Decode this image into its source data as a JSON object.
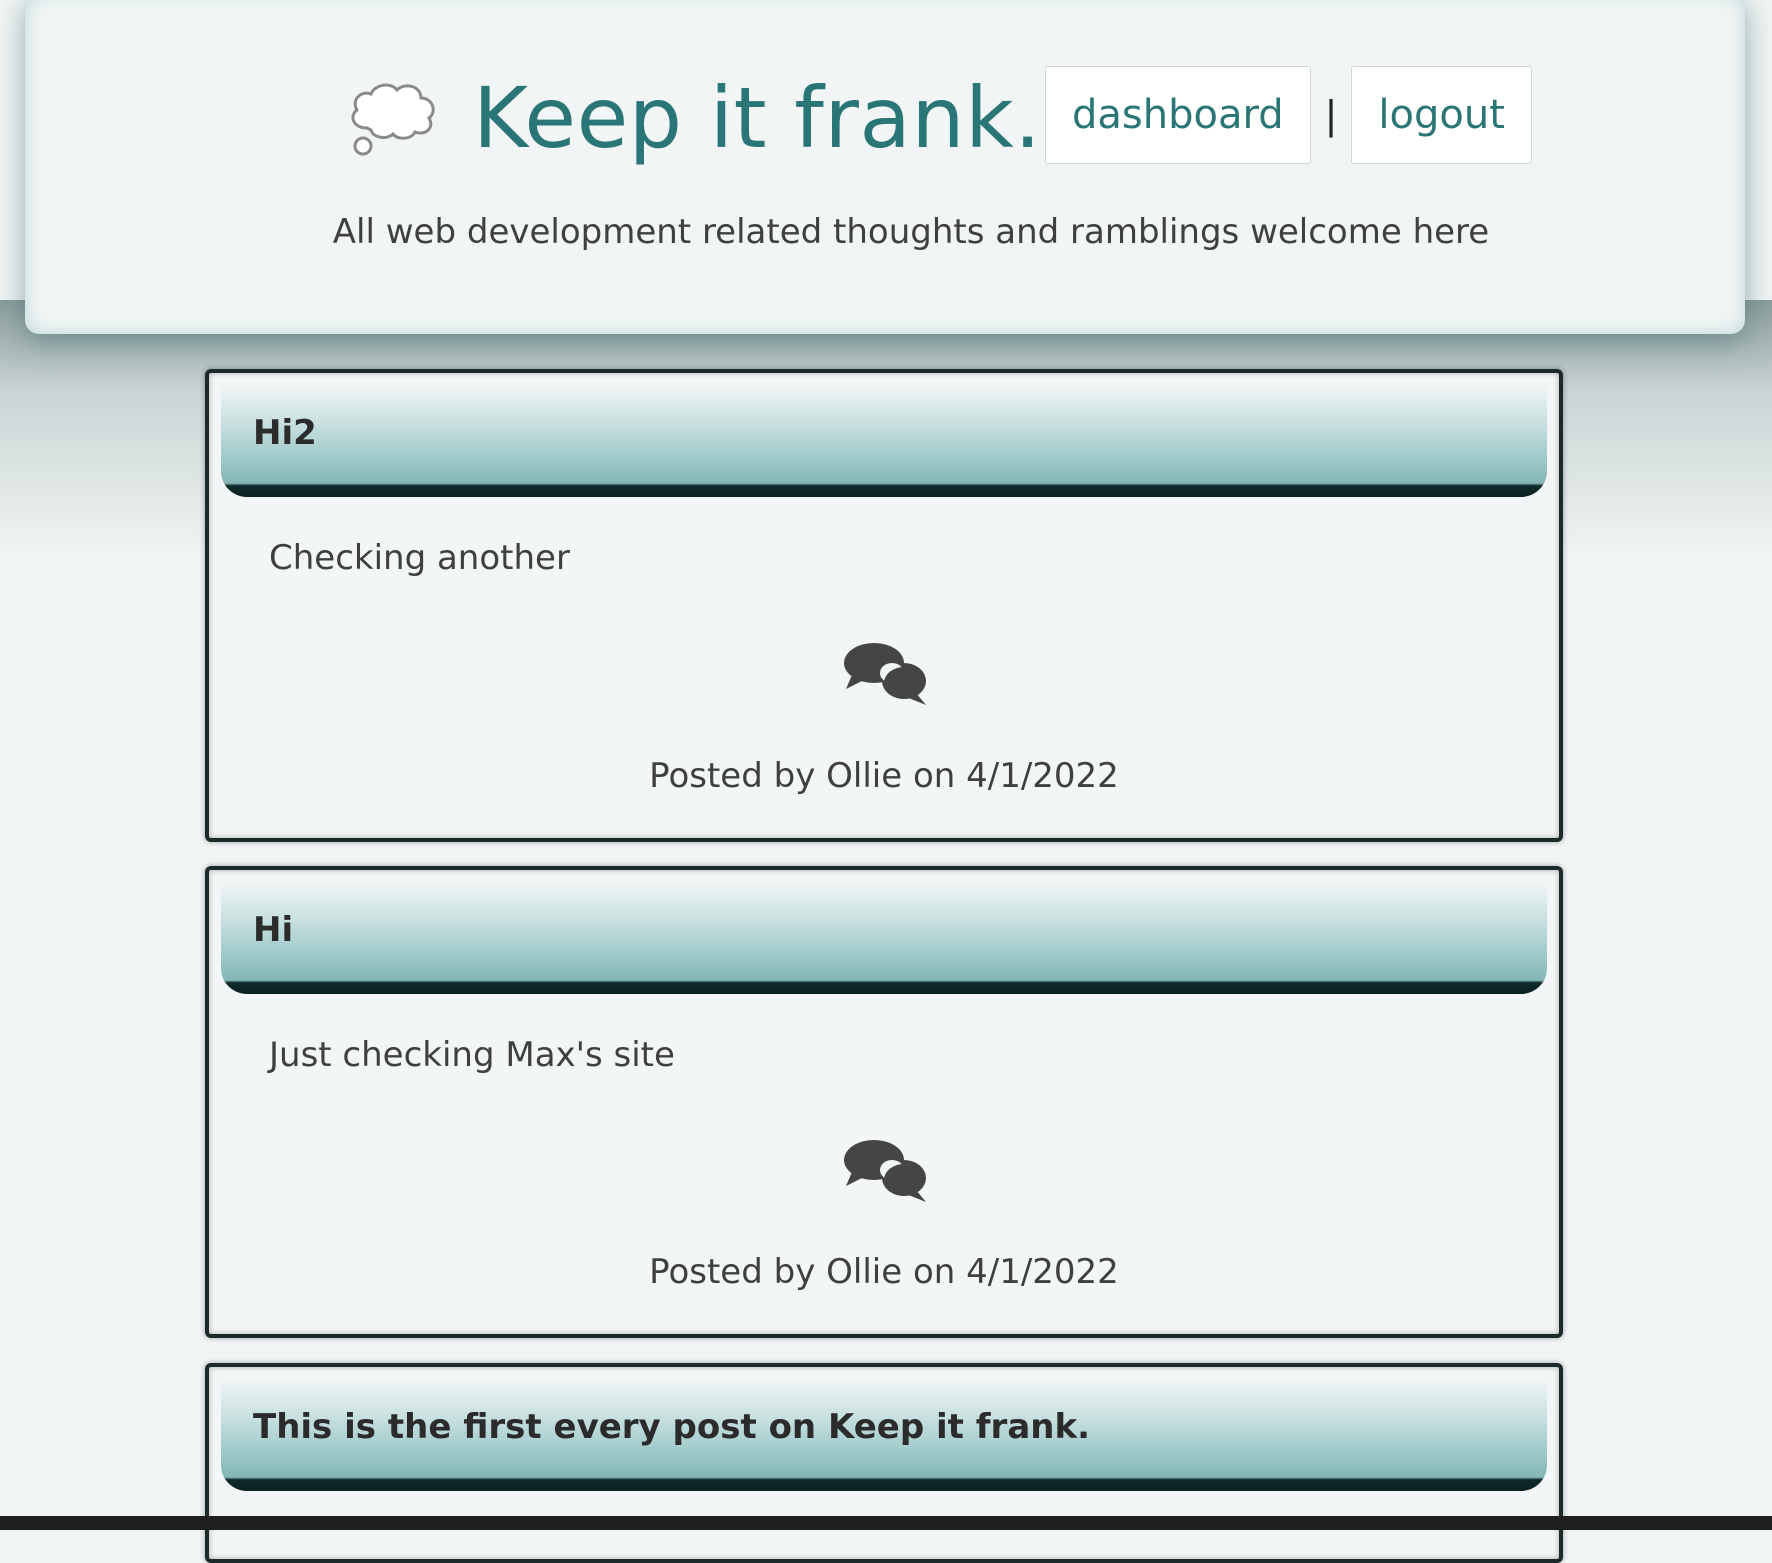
{
  "header": {
    "title": "Keep it frank.",
    "tagline": "All web development related thoughts and ramblings welcome here",
    "logo_icon": "thought-bubble-icon",
    "nav": {
      "dashboard_label": "dashboard",
      "separator": "|",
      "logout_label": "logout"
    }
  },
  "posts": [
    {
      "title": "Hi2",
      "body": "Checking another",
      "comment_icon": "comments-icon",
      "meta": "Posted by Ollie on 4/1/2022"
    },
    {
      "title": "Hi",
      "body": "Just checking Max's site",
      "comment_icon": "comments-icon",
      "meta": "Posted by Ollie on 4/1/2022"
    },
    {
      "title": "This is the first every post on Keep it frank.",
      "body": "",
      "comment_icon": "",
      "meta": ""
    }
  ],
  "colors": {
    "brand": "#2a7575",
    "page_bg": "#f1f5f5",
    "card_border": "#1c2a2a",
    "header_gradient_dark": "#0b2222",
    "header_gradient_light": "#99c6c6"
  }
}
